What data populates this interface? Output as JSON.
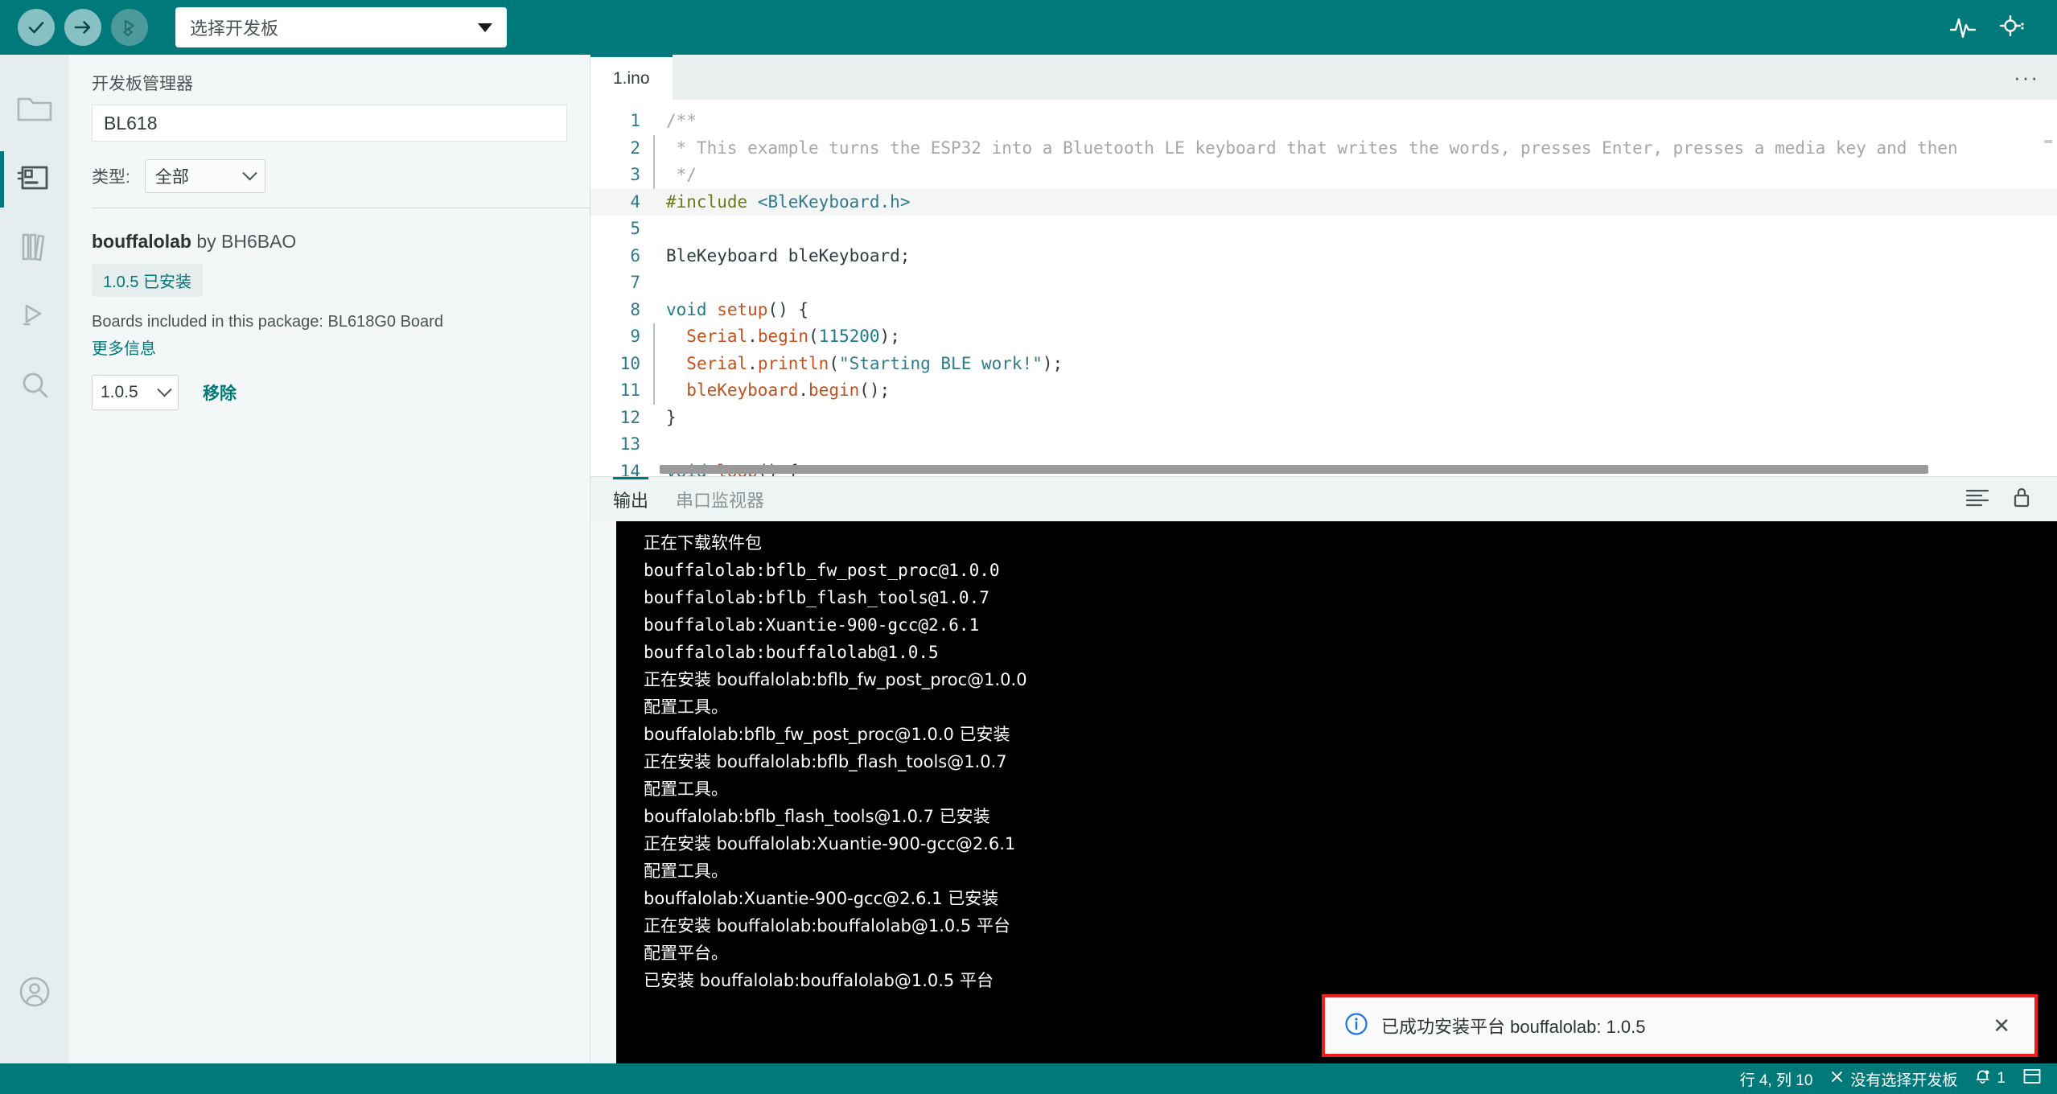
{
  "toolbar": {
    "verify_tooltip": "verify",
    "upload_tooltip": "upload",
    "debug_tooltip": "debug",
    "board_selector_label": "选择开发板",
    "serial_plotter_icon": "activity-icon",
    "serial_monitor_icon": "serial-monitor-icon",
    "accent_color": "#00797a"
  },
  "activity_bar": {
    "items": [
      {
        "name": "sketchbook",
        "icon": "folder-icon",
        "active": false
      },
      {
        "name": "boards-manager",
        "icon": "boards-manager-icon",
        "active": true
      },
      {
        "name": "library-manager",
        "icon": "library-icon",
        "active": false
      },
      {
        "name": "debug",
        "icon": "debug-icon",
        "active": false
      },
      {
        "name": "search",
        "icon": "search-icon",
        "active": false
      }
    ],
    "account_icon": "account-icon"
  },
  "boards_manager": {
    "title": "开发板管理器",
    "search_value": "BL618",
    "search_placeholder": "",
    "filter_label": "类型:",
    "filter_value": "全部",
    "package": {
      "name": "bouffalolab",
      "by": "by BH6BAO",
      "version_badge": "1.0.5 已安装",
      "description": "Boards included in this package: BL618G0 Board",
      "more_info": "更多信息",
      "version_selected": "1.0.5",
      "remove_label": "移除"
    }
  },
  "editor": {
    "tabs": [
      {
        "label": "1.ino",
        "active": true
      }
    ],
    "overflow_menu": "···",
    "lines": [
      {
        "num": "1",
        "highlight": false,
        "guide": false,
        "tokens": [
          {
            "t": "/**",
            "c": "cmt"
          }
        ]
      },
      {
        "num": "2",
        "highlight": false,
        "guide": true,
        "tokens": [
          {
            "t": " * This example turns the ESP32 into a Bluetooth LE keyboard that writes the words, presses Enter, presses a media key and then",
            "c": "cmt"
          }
        ]
      },
      {
        "num": "3",
        "highlight": false,
        "guide": true,
        "tokens": [
          {
            "t": " */",
            "c": "cmt"
          }
        ]
      },
      {
        "num": "4",
        "highlight": true,
        "guide": false,
        "tokens": [
          {
            "t": "#include",
            "c": "pre"
          },
          {
            "t": " ",
            "c": ""
          },
          {
            "t": "<BleKeyboard.h>",
            "c": "str"
          }
        ]
      },
      {
        "num": "5",
        "highlight": false,
        "guide": false,
        "tokens": []
      },
      {
        "num": "6",
        "highlight": false,
        "guide": false,
        "tokens": [
          {
            "t": "BleKeyboard bleKeyboard;",
            "c": ""
          }
        ]
      },
      {
        "num": "7",
        "highlight": false,
        "guide": false,
        "tokens": []
      },
      {
        "num": "8",
        "highlight": false,
        "guide": false,
        "tokens": [
          {
            "t": "void",
            "c": "kw"
          },
          {
            "t": " ",
            "c": ""
          },
          {
            "t": "setup",
            "c": "fn"
          },
          {
            "t": "() {",
            "c": ""
          }
        ]
      },
      {
        "num": "9",
        "highlight": false,
        "guide": true,
        "tokens": [
          {
            "t": "  ",
            "c": ""
          },
          {
            "t": "Serial",
            "c": "idn"
          },
          {
            "t": ".",
            "c": ""
          },
          {
            "t": "begin",
            "c": "idn"
          },
          {
            "t": "(",
            "c": ""
          },
          {
            "t": "115200",
            "c": "num"
          },
          {
            "t": ");",
            "c": ""
          }
        ]
      },
      {
        "num": "10",
        "highlight": false,
        "guide": true,
        "tokens": [
          {
            "t": "  ",
            "c": ""
          },
          {
            "t": "Serial",
            "c": "idn"
          },
          {
            "t": ".",
            "c": ""
          },
          {
            "t": "println",
            "c": "idn"
          },
          {
            "t": "(",
            "c": ""
          },
          {
            "t": "\"Starting BLE work!\"",
            "c": "str"
          },
          {
            "t": ");",
            "c": ""
          }
        ]
      },
      {
        "num": "11",
        "highlight": false,
        "guide": true,
        "tokens": [
          {
            "t": "  ",
            "c": ""
          },
          {
            "t": "bleKeyboard",
            "c": "idn"
          },
          {
            "t": ".",
            "c": ""
          },
          {
            "t": "begin",
            "c": "idn"
          },
          {
            "t": "();",
            "c": ""
          }
        ]
      },
      {
        "num": "12",
        "highlight": false,
        "guide": false,
        "tokens": [
          {
            "t": "}",
            "c": ""
          }
        ]
      },
      {
        "num": "13",
        "highlight": false,
        "guide": false,
        "tokens": []
      },
      {
        "num": "14",
        "highlight": false,
        "guide": false,
        "tokens": [
          {
            "t": "void",
            "c": "kw"
          },
          {
            "t": " ",
            "c": ""
          },
          {
            "t": "loop",
            "c": "fn"
          },
          {
            "t": "() {",
            "c": ""
          }
        ]
      }
    ]
  },
  "bottom_panel": {
    "tabs": [
      {
        "label": "输出",
        "active": true
      },
      {
        "label": "串口监视器",
        "active": false
      }
    ],
    "tools": [
      {
        "name": "clear-output-icon"
      },
      {
        "name": "lock-icon"
      }
    ],
    "console_lines": [
      {
        "text": "正在下载软件包",
        "zh": true
      },
      {
        "text": "bouffalolab:bflb_fw_post_proc@1.0.0",
        "zh": false
      },
      {
        "text": "bouffalolab:bflb_flash_tools@1.0.7",
        "zh": false
      },
      {
        "text": "bouffalolab:Xuantie-900-gcc@2.6.1",
        "zh": false
      },
      {
        "text": "bouffalolab:bouffalolab@1.0.5",
        "zh": false
      },
      {
        "text": "正在安装 bouffalolab:bflb_fw_post_proc@1.0.0",
        "zh": true
      },
      {
        "text": "配置工具。",
        "zh": true
      },
      {
        "text": "bouffalolab:bflb_fw_post_proc@1.0.0 已安装",
        "zh": true
      },
      {
        "text": "正在安装 bouffalolab:bflb_flash_tools@1.0.7",
        "zh": true
      },
      {
        "text": "配置工具。",
        "zh": true
      },
      {
        "text": "bouffalolab:bflb_flash_tools@1.0.7 已安装",
        "zh": true
      },
      {
        "text": "正在安装 bouffalolab:Xuantie-900-gcc@2.6.1",
        "zh": true
      },
      {
        "text": "配置工具。",
        "zh": true
      },
      {
        "text": "bouffalolab:Xuantie-900-gcc@2.6.1 已安装",
        "zh": true
      },
      {
        "text": "正在安装 bouffalolab:bouffalolab@1.0.5 平台",
        "zh": true
      },
      {
        "text": "配置平台。",
        "zh": true
      },
      {
        "text": "已安装 bouffalolab:bouffalolab@1.0.5 平台",
        "zh": true
      }
    ]
  },
  "toast": {
    "icon": "info-icon",
    "message": "已成功安装平台 bouffalolab:  1.0.5",
    "close_label": "✕",
    "border_color": "#f01d1d",
    "icon_color": "#1a73e8"
  },
  "status_bar": {
    "cursor_position": "行 4, 列 10",
    "board_status_icon": "x-icon",
    "board_status": "没有选择开发板",
    "notifications_icon": "bell-icon",
    "notifications_count": "1",
    "layout_icon": "panel-layout-icon"
  }
}
